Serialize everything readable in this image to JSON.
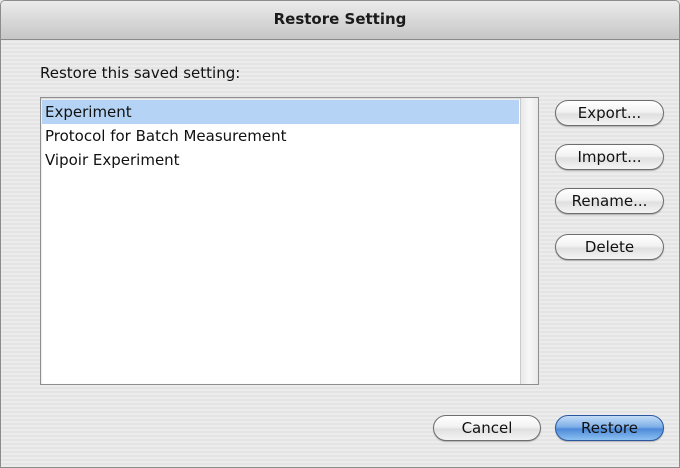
{
  "window": {
    "title": "Restore Setting"
  },
  "dialog": {
    "prompt": "Restore this saved setting:"
  },
  "settings_list": {
    "items": [
      {
        "label": "Experiment",
        "selected": true
      },
      {
        "label": "Protocol for Batch Measurement",
        "selected": false
      },
      {
        "label": "Vipoir Experiment",
        "selected": false
      }
    ]
  },
  "side_buttons": {
    "export_label": "Export...",
    "import_label": "Import...",
    "rename_label": "Rename...",
    "delete_label": "Delete"
  },
  "footer_buttons": {
    "cancel_label": "Cancel",
    "restore_label": "Restore"
  },
  "colors": {
    "selection": "#b5d3f4",
    "default_button": "#5a93dc"
  }
}
